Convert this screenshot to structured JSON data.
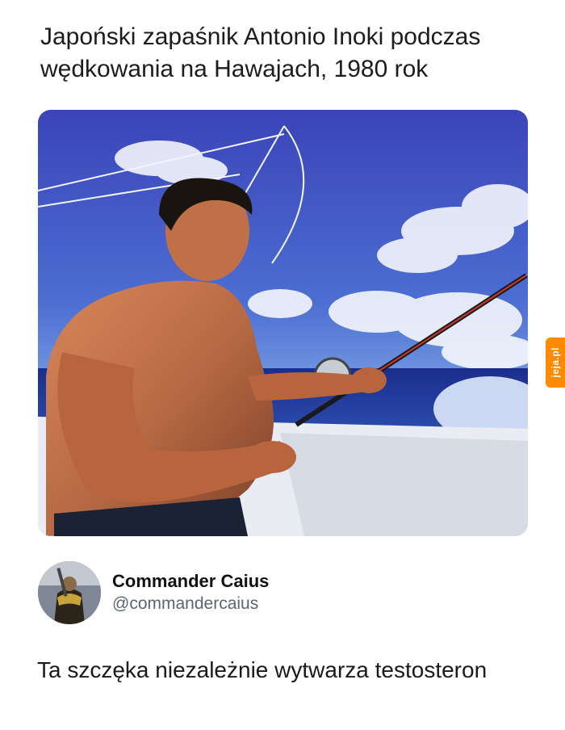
{
  "headline": "Japoński zapaśnik Antonio Inoki podczas wędkowania na Hawajach, 1980 rok",
  "photo": {
    "subject": "image-photo"
  },
  "watermark": {
    "text": "jeja.pl",
    "color": "#ff8a00"
  },
  "author": {
    "display_name": "Commander Caius",
    "handle": "@commandercaius"
  },
  "tweet": {
    "text": "Ta szczęka niezależnie wytwarza testosteron"
  }
}
